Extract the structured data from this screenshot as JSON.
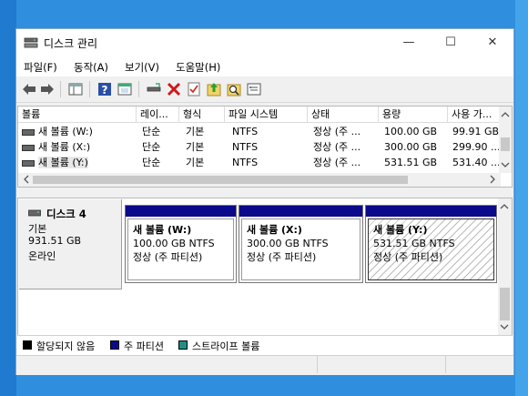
{
  "window": {
    "title": "디스크 관리",
    "controls": {
      "minimize": "—",
      "maximize": "☐",
      "close": "✕"
    }
  },
  "menu": [
    "파일(F)",
    "동작(A)",
    "보기(V)",
    "도움말(H)"
  ],
  "toolbar_icons": [
    "back-icon",
    "forward-icon",
    "console-tree-icon",
    "help-icon",
    "properties-icon",
    "connect-icon",
    "delete-icon",
    "check-icon",
    "upload-icon",
    "search-icon",
    "list-icon"
  ],
  "volume_list": {
    "headers": [
      "볼륨",
      "레이...",
      "형식",
      "파일 시스템",
      "상태",
      "용량",
      "사용 가..."
    ],
    "rows": [
      [
        "새 볼륨 (W:)",
        "단순",
        "기본",
        "NTFS",
        "정상 (주 ...",
        "100.00 GB",
        "99.91 GB"
      ],
      [
        "새 볼륨 (X:)",
        "단순",
        "기본",
        "NTFS",
        "정상 (주 ...",
        "300.00 GB",
        "299.90 ..."
      ],
      [
        "새 볼륨 (Y:)",
        "단순",
        "기본",
        "NTFS",
        "정상 (주 ...",
        "531.51 GB",
        "531.40 ..."
      ]
    ]
  },
  "disk": {
    "name": "디스크 4",
    "type": "기본",
    "size": "931.51 GB",
    "status": "온라인",
    "partitions": [
      {
        "name": "새 볼륨  (W:)",
        "size_fs": "100.00 GB NTFS",
        "status": "정상 (주 파티션)"
      },
      {
        "name": "새 볼륨  (X:)",
        "size_fs": "300.00 GB NTFS",
        "status": "정상 (주 파티션)"
      },
      {
        "name": "새 볼륨  (Y:)",
        "size_fs": "531.51 GB NTFS",
        "status": "정상 (주 파티션)"
      }
    ]
  },
  "legend": [
    {
      "label": "할당되지 않음",
      "color": "#000000"
    },
    {
      "label": "주 파티션",
      "color": "#0a0a8a"
    },
    {
      "label": "스트라이프 볼륨",
      "color": "#1f8f86"
    }
  ]
}
